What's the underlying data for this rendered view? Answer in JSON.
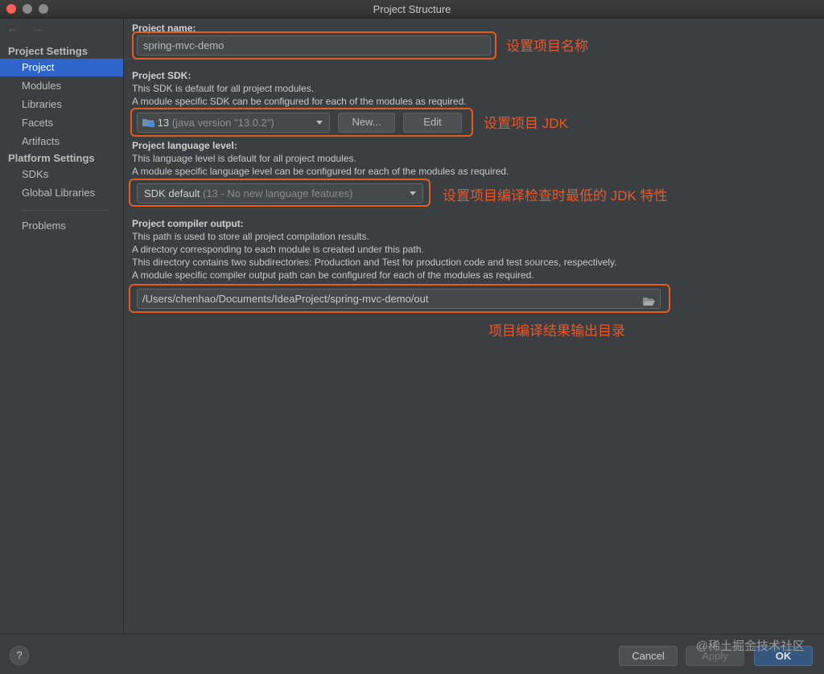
{
  "window": {
    "title": "Project Structure"
  },
  "sidebar": {
    "nav_arrows": "← →",
    "project_settings_header": "Project Settings",
    "project_items": [
      "Project",
      "Modules",
      "Libraries",
      "Facets",
      "Artifacts"
    ],
    "selected": "Project",
    "platform_settings_header": "Platform Settings",
    "platform_items": [
      "SDKs",
      "Global Libraries"
    ],
    "problems": "Problems"
  },
  "project_name": {
    "label": "Project name:",
    "value": "spring-mvc-demo",
    "annotation": "设置项目名称"
  },
  "project_sdk": {
    "label": "Project SDK:",
    "desc1": "This SDK is default for all project modules.",
    "desc2": "A module specific SDK can be configured for each of the modules as required.",
    "selected_version": "13",
    "selected_detail": "(java version \"13.0.2\")",
    "new_button": "New...",
    "edit_button": "Edit",
    "annotation": "设置项目 JDK"
  },
  "language_level": {
    "label": "Project language level:",
    "desc1": "This language level is default for all project modules.",
    "desc2": "A module specific language level can be configured for each of the modules as required.",
    "selected_main": "SDK default",
    "selected_detail": "(13 - No new language features)",
    "annotation": "设置项目编译检查时最低的 JDK 特性"
  },
  "compiler_output": {
    "label": "Project compiler output:",
    "desc1": "This path is used to store all project compilation results.",
    "desc2": "A directory corresponding to each module is created under this path.",
    "desc3": "This directory contains two subdirectories: Production and Test for production code and test sources, respectively.",
    "desc4": "A module specific compiler output path can be configured for each of the modules as required.",
    "value": "/Users/chenhao/Documents/IdeaProject/spring-mvc-demo/out",
    "annotation": "项目编译结果输出目录"
  },
  "footer": {
    "help": "?",
    "cancel": "Cancel",
    "apply": "Apply",
    "ok": "OK",
    "watermark": "@稀土掘金技术社区"
  },
  "colors": {
    "accent": "#2f65ca",
    "highlight": "#e35d22",
    "annotation": "#e8582a"
  },
  "icons": {
    "sdk": "folder-icon",
    "browse": "folder-open-icon",
    "help": "help-icon"
  }
}
